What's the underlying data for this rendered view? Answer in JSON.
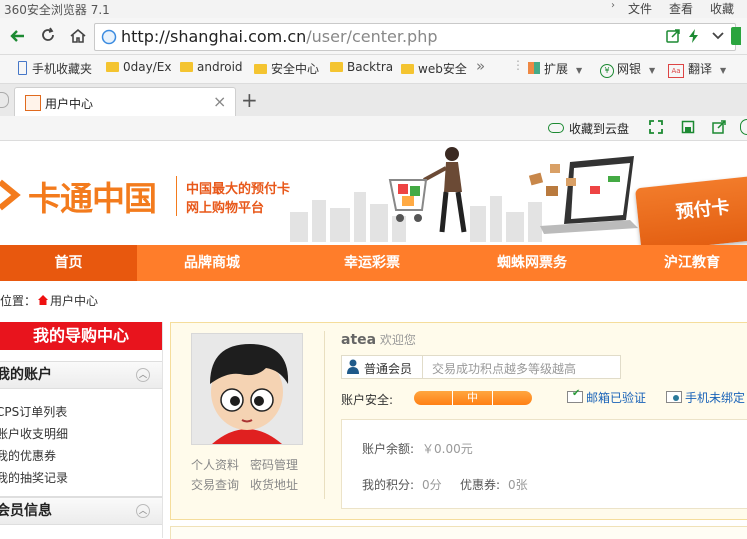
{
  "browser": {
    "title": "360安全浏览器 7.1",
    "menu": [
      "文件",
      "查看",
      "收藏"
    ],
    "url_host": "http://shanghai.com.cn",
    "url_path": "/user/center.php",
    "bookmarks": [
      "手机收藏夹",
      "0day/Ex",
      "android",
      "安全中心",
      "Backtra",
      "web安全"
    ],
    "more_chevron": "»",
    "extensions": [
      "扩展",
      "网银",
      "翻译"
    ],
    "tab_title": "用户中心",
    "tab_close": "×",
    "new_tab": "+",
    "cloud_favorite": "收藏到云盘"
  },
  "site": {
    "logo_text": "卡通中国",
    "slogan_line1": "中国最大的预付卡",
    "slogan_line2": "网上购物平台",
    "card_text": "预付卡",
    "nav": [
      "首页",
      "品牌商城",
      "幸运彩票",
      "蜘蛛网票务",
      "沪江教育"
    ],
    "breadcrumb_prefix": "位置：",
    "breadcrumb_page": "用户中心"
  },
  "sidebar": {
    "header": "我的导购中心",
    "my_account": "我的账户",
    "account_links": [
      "CPS订单列表",
      "账户收支明细",
      "我的优惠券",
      "我的抽奖记录"
    ],
    "member_info": "会员信息"
  },
  "profile": {
    "username": "atea",
    "welcome": "欢迎您",
    "member_level": "普通会员",
    "level_hint": "交易成功积点越多等级越高",
    "security_label": "账户安全:",
    "security_level": "中",
    "security_percent": 50,
    "email_status": "邮箱已验证",
    "phone_status": "手机未绑定",
    "links": [
      "个人资料",
      "密码管理",
      "交易查询",
      "收货地址"
    ],
    "balance_label": "账户余额:",
    "balance_value": "￥0.00元",
    "points_label": "我的积分:",
    "points_value": "0分",
    "coupon_label": "优惠券:",
    "coupon_value": "0张"
  },
  "colors": {
    "nav_orange": "#ff7d2a",
    "nav_active": "#e8580e",
    "sidebar_red": "#e8141d",
    "link_blue": "#1a63b8",
    "security_orange": "#ff8a1f"
  }
}
